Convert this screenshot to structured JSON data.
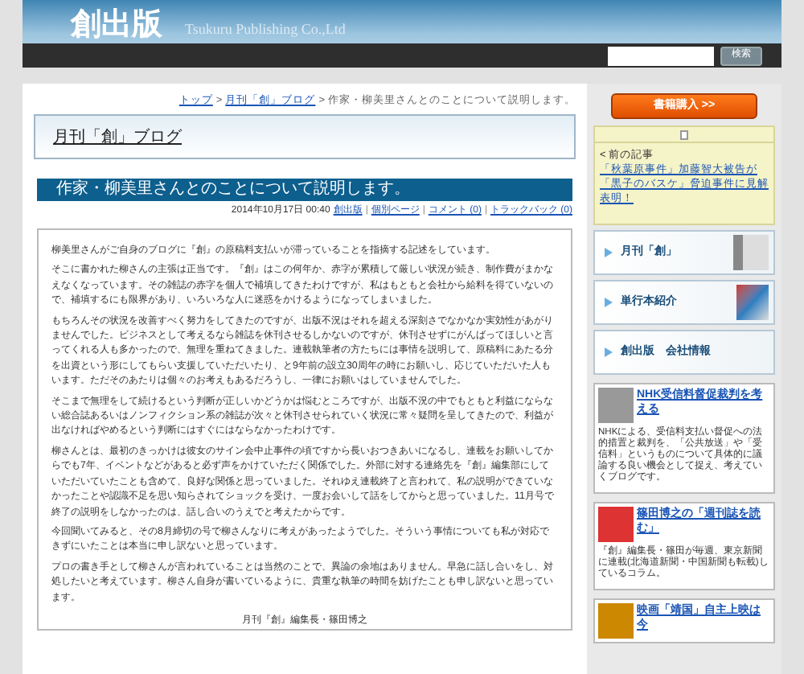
{
  "header": {
    "logo": "創出版",
    "company": "Tsukuru Publishing Co.,Ltd",
    "search_button": "検索"
  },
  "breadcrumb": [
    {
      "label": "トップ",
      "link": true
    },
    {
      "separator": ">",
      "label": "月刊「創」ブログ",
      "link": true
    },
    {
      "separator": ">",
      "label": "作家・柳美里さんとのことについて説明します。",
      "link": false
    }
  ],
  "blog_title": "月刊「創」ブログ",
  "post": {
    "title": "作家・柳美里さんとのことについて説明します。",
    "date": "2014年10月17日 00:40",
    "meta_links": [
      {
        "label": "創出版"
      },
      {
        "separator": "|",
        "label": "個別ページ"
      },
      {
        "separator": "|",
        "label": "コメント (0)"
      },
      {
        "separator": "|",
        "label": "トラックバック (0)"
      }
    ],
    "paragraphs": [
      "柳美里さんがご自身のブログに『創』の原稿料支払いが滞っていることを指摘する記述をしています。",
      "そこに書かれた柳さんの主張は正当です。『創』はこの何年か、赤字が累積して厳しい状況が続き、制作費がまかなえなくなっています。その雑誌の赤字を個人で補填してきたわけですが、私はもともと会社から給料を得ていないので、補填するにも限界があり、いろいろな人に迷惑をかけるようになってしまいました。",
      "もちろんその状況を改善すべく努力をしてきたのですが、出版不況はそれを超える深刻さでなかなか実効性があがりませんでした。ビジネスとして考えるなら雑誌を休刊させるしかないのですが、休刊させずにがんばってほしいと言ってくれる人も多かったので、無理を重ねてきました。連載執筆者の方たちには事情を説明して、原稿料にあたる分を出資という形にしてもらい支援していただいたり、と9年前の設立30周年の時にお願いし、応じていただいた人もいます。ただそのあたりは個々のお考えもあるだろうし、一律にお願いはしていませんでした。",
      "そこまで無理をして続けるという判断が正しいかどうかは悩むところですが、出版不況の中でもともと利益にならない総合誌あるいはノンフィクション系の雑誌が次々と休刊させられていく状況に常々疑問を呈してきたので、利益が出なければやめるという判断にはすぐにはならなかったわけです。",
      "柳さんとは、最初のきっかけは彼女のサイン会中止事件の頃ですから長いおつきあいになるし、連載をお願いしてからでも7年、イベントなどがあると必ず声をかけていただく関係でした。外部に対する連絡先を『創』編集部にしていただいていたことも含めて、良好な関係と思っていました。それゆえ連載終了と言われて、私の説明ができていなかったことや認識不足を思い知らされてショックを受け、一度お会いして話をしてからと思っていました。11月号で終了の説明をしなかったのは、話し合いのうえでと考えたからです。",
      "今回聞いてみると、その8月締切の号で柳さんなりに考えがあったようでした。そういう事情についても私が対応できずにいたことは本当に申し訳ないと思っています。",
      "プロの書き手として柳さんが言われていることは当然のことで、異論の余地はありません。早急に話し合いをし、対処したいと考えています。柳さん自身が書いているように、貴重な執筆の時間を妨げたことも申し訳ないと思っています。"
    ],
    "signature": "月刊『創』編集長・篠田博之"
  },
  "sidebar": {
    "buy_button": "書籍購入 >>",
    "prev_label": "< 前の記事",
    "prev_link": "「秋葉原事件」加藤智大被告が「黒子のバスケ」脅迫事件に見解表明！",
    "menu": [
      {
        "label": "月刊「創」",
        "kind": "magazine"
      },
      {
        "label": "単行本紹介",
        "kind": "books"
      },
      {
        "label": "創出版　会社情報",
        "kind": "plain"
      }
    ],
    "blogs": [
      {
        "title": "NHK受信料督促裁判を考える",
        "text": "NHKによる、受信料支払い督促への法的措置と裁判を、「公共放送」や「受信料」というものについて具体的に議論する良い機会として捉え、考えていくブログです。"
      },
      {
        "title": "篠田博之の「週刊誌を読む」",
        "text": "『創』編集長・篠田が毎週、東京新聞に連載(北海道新聞・中国新聞も転載)しているコラム。"
      },
      {
        "title": "映画「靖国」自主上映は今"
      }
    ]
  }
}
